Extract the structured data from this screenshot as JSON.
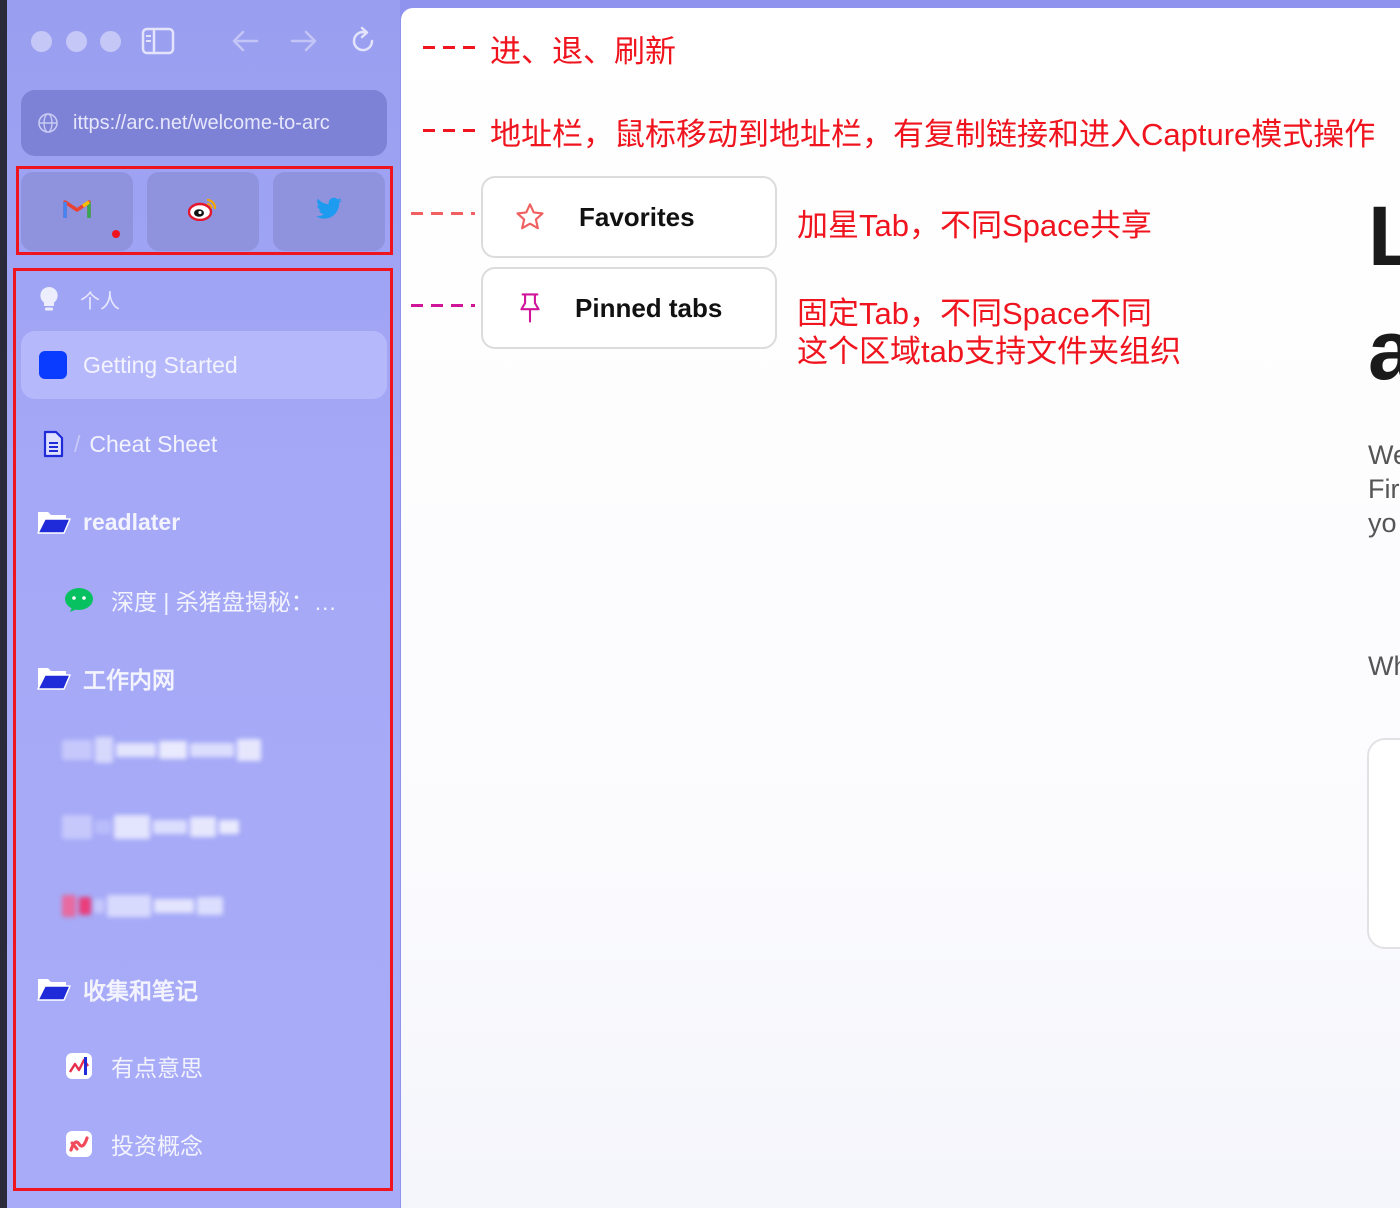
{
  "sidebar": {
    "url": "ittps://arc.net/welcome-to-arc",
    "space_name": "个人",
    "tabs": {
      "getting_started": "Getting Started",
      "cheat_sheet": "Cheat Sheet",
      "readlater": "readlater",
      "wechat_article": "深度 | 杀猪盘揭秘：…",
      "work_intranet": "工作内网",
      "collect_notes": "收集和笔记",
      "interesting": "有点意思",
      "invest_concepts": "投资概念"
    }
  },
  "annotations": {
    "nav": "进、退、刷新",
    "address_bar": "地址栏，鼠标移动到地址栏，有复制链接和进入Capture模式操作",
    "favorites_label": "Favorites",
    "favorites_desc": "加星Tab，不同Space共享",
    "pinned_label": "Pinned tabs",
    "pinned_desc_1": "固定Tab，不同Space不同",
    "pinned_desc_2": "这个区域tab支持文件夹组织",
    "dash_prefix": "---"
  },
  "page_peek": {
    "big_1": "L",
    "big_2": "a",
    "line_1": "We",
    "line_2": "Fir",
    "line_3": "yo",
    "line_4": "Wh"
  },
  "icons": {
    "nav": [
      "sidebar-toggle-icon",
      "back-arrow-icon",
      "forward-arrow-icon",
      "reload-icon"
    ],
    "favorites": [
      "gmail-icon",
      "weibo-icon",
      "twitter-icon"
    ]
  },
  "colors": {
    "accent_red": "#f0141e",
    "sidebar_bg": "#a4a8f6",
    "active_tab": "#b5b8fa"
  }
}
